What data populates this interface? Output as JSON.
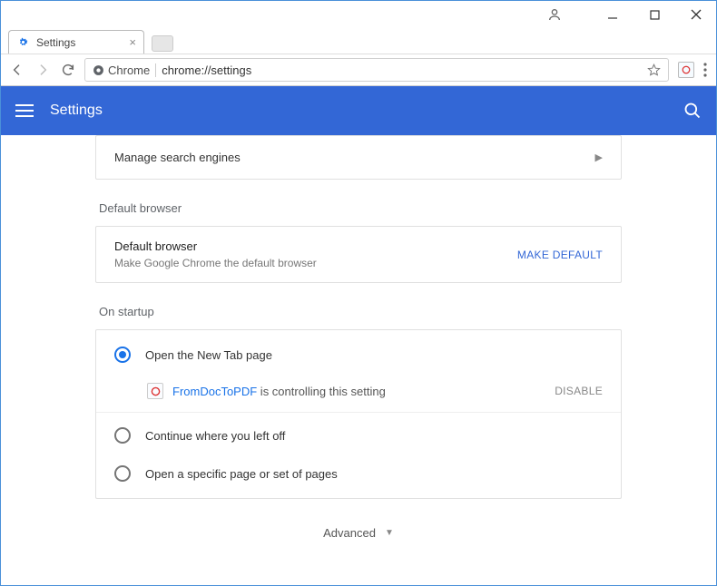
{
  "window": {
    "tab_label": "Settings"
  },
  "addressbar": {
    "scheme_label": "Chrome",
    "url": "chrome://settings"
  },
  "header": {
    "title": "Settings"
  },
  "search_engines": {
    "label": "Manage search engines"
  },
  "default_browser": {
    "section_label": "Default browser",
    "title": "Default browser",
    "subtitle": "Make Google Chrome the default browser",
    "button": "MAKE DEFAULT"
  },
  "startup": {
    "section_label": "On startup",
    "options": [
      "Open the New Tab page",
      "Continue where you left off",
      "Open a specific page or set of pages"
    ],
    "extension_name": "FromDocToPDF",
    "extension_suffix": " is controlling this setting",
    "disable_label": "DISABLE"
  },
  "advanced": {
    "label": "Advanced"
  }
}
